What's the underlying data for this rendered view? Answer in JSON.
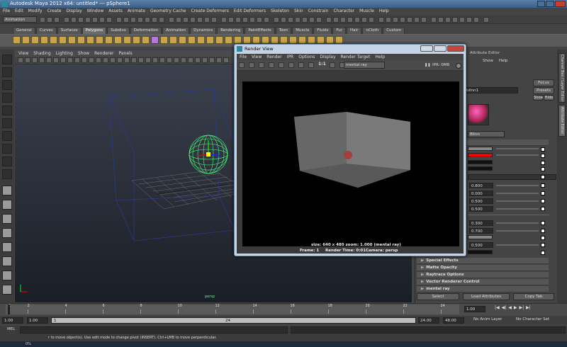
{
  "window": {
    "title": "Autodesk Maya 2012 x64: untitled*  ---  pSphere1"
  },
  "menus": [
    "File",
    "Edit",
    "Modify",
    "Create",
    "Display",
    "Window",
    "Assets",
    "Animate",
    "Geometry Cache",
    "Create Deformers",
    "Edit Deformers",
    "Skeleton",
    "Skin",
    "Constrain",
    "Character",
    "Muscle",
    "Help"
  ],
  "mode_menu": "Animation",
  "shelf_tabs": [
    "General",
    "Curves",
    "Surfaces",
    "Polygons",
    "Subdivs",
    "Deformation",
    "Animation",
    "Dynamics",
    "Rendering",
    "PaintEffects",
    "Toon",
    "Muscle",
    "Fluids",
    "Fur",
    "Hair",
    "nCloth",
    "Custom"
  ],
  "active_shelf_tab": "Polygons",
  "viewport": {
    "menus": [
      "View",
      "Shading",
      "Lighting",
      "Show",
      "Renderer",
      "Panels"
    ],
    "corner_label": "persp"
  },
  "render_view": {
    "title": "Render View",
    "menus": [
      "File",
      "View",
      "Render",
      "IPR",
      "Options",
      "Display",
      "Render Target",
      "Help"
    ],
    "ratio_label": "1:1",
    "renderer": "mental ray",
    "ipr_label": "IPR: 0MB",
    "info_line1": "size: 640 x 480  zoom: 1.000        (mental ray)",
    "info_frame": "Frame: 1",
    "info_time": "Render Time: 0:01",
    "info_camera": "Camera: persp"
  },
  "attribute_editor": {
    "header": "Attribute Editor",
    "menus": [
      "Show",
      "Help"
    ],
    "shader_name": "blinn1",
    "focus": "Focus",
    "presets": "Presets",
    "show": "Show",
    "hide": "Hide",
    "type_value": "Blinn",
    "section_common": "ttributes",
    "fields": [
      "0.800",
      "0.000",
      "0.500",
      "0.500"
    ],
    "fields2": [
      "0.300",
      "0.700",
      "0.500"
    ],
    "sections": [
      "Special Effects",
      "Matte Opacity",
      "Raytrace Options",
      "Vector Renderer Control",
      "mental ray"
    ],
    "bottom_buttons": [
      "Select",
      "Load Attributes",
      "Copy Tab"
    ],
    "side_tabs": [
      "Channel Box / Layer Editor",
      "Attribute Editor"
    ]
  },
  "timeline": {
    "ticks": [
      "1",
      "2",
      "4",
      "6",
      "8",
      "10",
      "12",
      "14",
      "16",
      "18",
      "20",
      "22",
      "24"
    ],
    "current_frame": "1.00"
  },
  "range": {
    "start": "1.00",
    "start2": "1.00",
    "marker": "1",
    "marker_end": "24",
    "end": "24.00",
    "end2": "48.00",
    "anim_layer": "No Anim Layer",
    "char_set": "No Character Set"
  },
  "command_line": {
    "label": "MEL"
  },
  "help_line": "r to move object(s). Use edit mode to change pivot (INSERT).  Ctrl+LMB to move perpendicular.",
  "taskbar": {
    "percent": "0%"
  },
  "colors": {
    "accent_green": "#4dff7a",
    "title_blue": "#3b5f87",
    "swatch_red": "#ff0000"
  }
}
